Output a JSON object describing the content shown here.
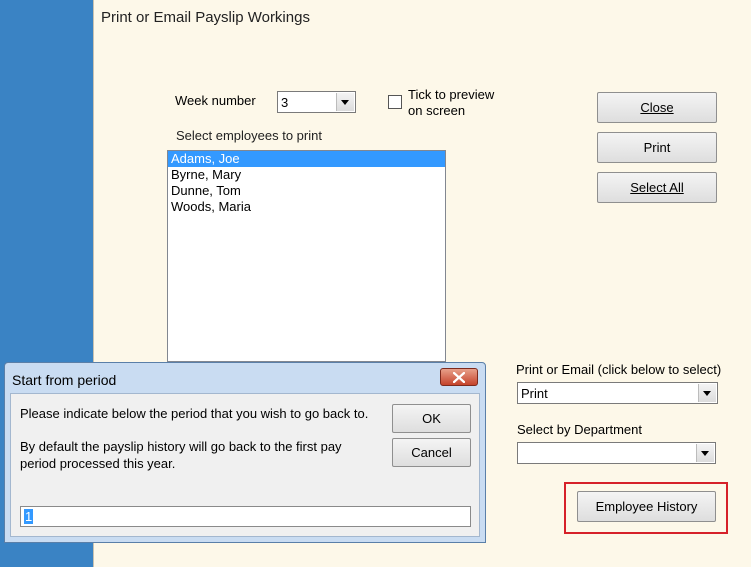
{
  "main": {
    "title": "Print or Email Payslip Workings",
    "week_label": "Week number",
    "week_value": "3",
    "preview_label_line1": "Tick to preview",
    "preview_label_line2": "on screen",
    "select_employees_label": "Select employees to print",
    "employees": [
      "Adams, Joe",
      "Byrne, Mary",
      "Dunne, Tom",
      "Woods, Maria"
    ],
    "selected_employee": "Adams, Joe",
    "close_button": "Close",
    "print_button": "Print",
    "select_all_button": "Select All",
    "print_or_email_label": "Print or Email (click below to select)",
    "print_or_email_value": "Print",
    "department_label": "Select by Department",
    "department_value": "",
    "employee_history_button": "Employee History"
  },
  "dialog": {
    "title": "Start from period",
    "message1": "Please indicate below the period that you wish to go back to.",
    "message2_line1": "By default the payslip history will go back to the first pay",
    "message2_line2": "period processed this year.",
    "ok_button": "OK",
    "cancel_button": "Cancel",
    "period_value": "1"
  },
  "colors": {
    "highlight": "#d62129",
    "selection": "#3399ff",
    "window_bg": "#fdf8e9"
  }
}
